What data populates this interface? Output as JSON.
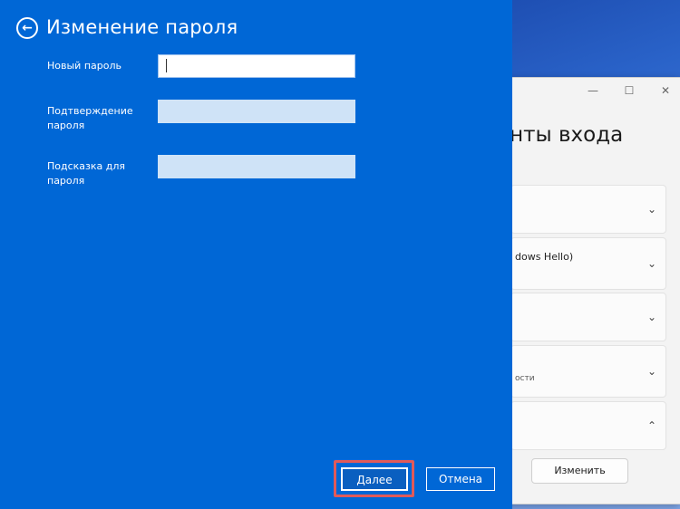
{
  "dialog": {
    "title": "Изменение пароля",
    "fields": [
      {
        "label": "Новый пароль",
        "value": ""
      },
      {
        "label": "Подтверждение пароля",
        "value": ""
      },
      {
        "label": "Подсказка для пароля",
        "value": ""
      }
    ],
    "next_label": "Далее",
    "cancel_label": "Отмена"
  },
  "settings": {
    "title_partial": "анты входа",
    "card2_text": "dows Hello)",
    "card4_sub": "ости",
    "change_label": "Изменить"
  },
  "colors": {
    "dialog_bg": "#0067d6",
    "highlight": "#e05a5a"
  }
}
